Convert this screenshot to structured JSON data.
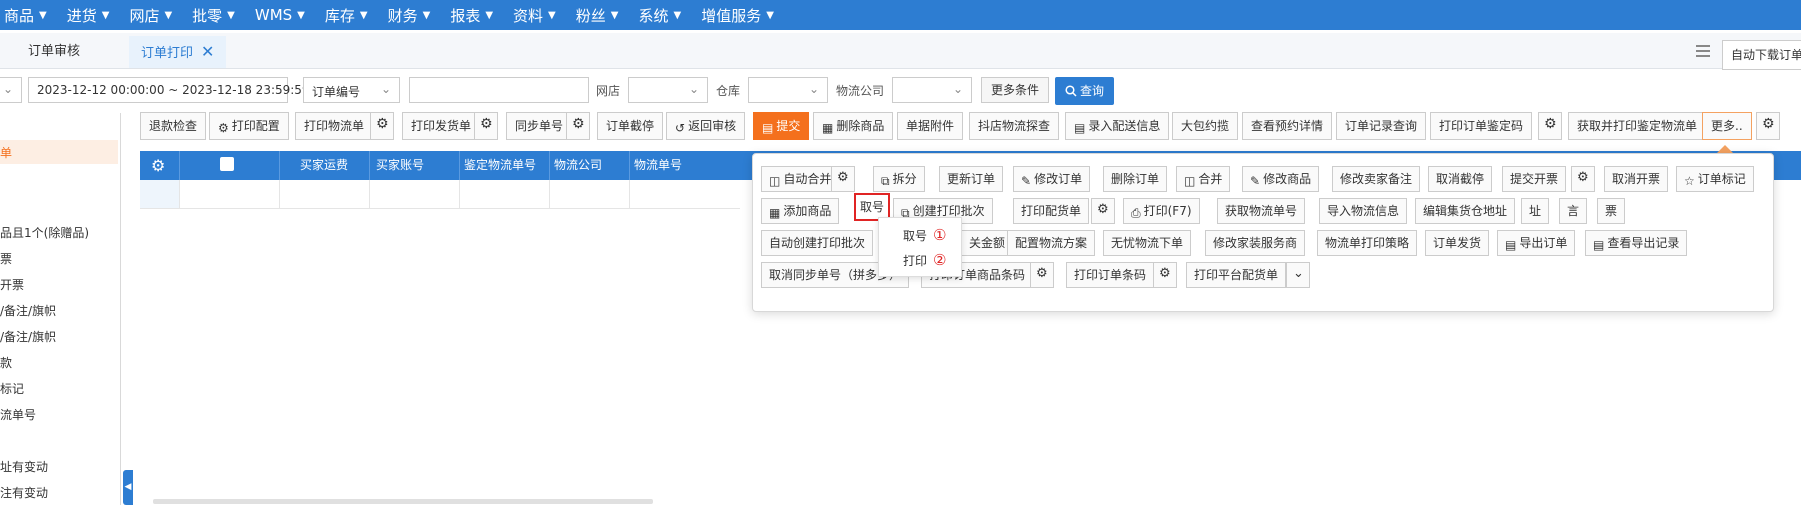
{
  "nav": {
    "items": [
      "商品",
      "进货",
      "网店",
      "批零",
      "WMS",
      "库存",
      "财务",
      "报表",
      "资料",
      "粉丝",
      "系统",
      "增值服务"
    ]
  },
  "tabs": {
    "items": [
      "订单审核",
      "订单打印"
    ],
    "active": "订单打印",
    "auto_download": "自动下载订单"
  },
  "filters": {
    "date_range": "2023-12-12 00:00:00 ~ 2023-12-18 23:59:59",
    "order_field": "订单编号",
    "order_value": "",
    "shop_label": "网店",
    "warehouse_label": "仓库",
    "logistics_label": "物流公司",
    "more_conditions": "更多条件",
    "query": "查询"
  },
  "left_panel": {
    "items": [
      "单",
      "品且1个(除赠品)",
      "票",
      "开票",
      "/备注/旗帜",
      "/备注/旗帜",
      "款",
      "标记",
      "流单号",
      "址有变动",
      "注有变动"
    ]
  },
  "toolbar": {
    "refund_check": "退款检查",
    "print_config": "打印配置",
    "print_logistics": "打印物流单",
    "print_shipping": "打印发货单",
    "sync_number": "同步单号",
    "order_intercept": "订单截停",
    "return_review": "返回审核",
    "submit": "提交",
    "delete_goods": "删除商品",
    "receipt_attach": "单据附件",
    "douyin_logistics": "抖店物流探查",
    "entry_delivery": "录入配送信息",
    "big_package": "大包约揽",
    "view_appointment": "查看预约详情",
    "order_record_query": "订单记录查询",
    "print_identify_code": "打印订单鉴定码",
    "fetch_print_identify": "获取并打印鉴定物流单",
    "more": "更多.."
  },
  "table": {
    "columns": [
      "买家运费",
      "买家账号",
      "鉴定物流单号",
      "物流公司",
      "物流单号"
    ]
  },
  "more_panel": {
    "row1": {
      "auto_merge": "自动合并",
      "split": "拆分",
      "update_order": "更新订单",
      "modify_order": "修改订单",
      "delete_order": "删除订单",
      "merge": "合并",
      "modify_goods": "修改商品",
      "modify_seller_note": "修改卖家备注",
      "cancel_intercept": "取消截停",
      "submit_invoice": "提交开票",
      "cancel_invoice": "取消开票",
      "order_mark": "订单标记"
    },
    "row2": {
      "add_goods": "添加商品",
      "take_number": "取号",
      "create_print_batch": "创建打印批次",
      "print_picking": "打印配货单",
      "print_f7": "打印(F7)",
      "get_logistics_number": "获取物流单号",
      "import_logistics": "导入物流信息",
      "edit_consolidation_address": "编辑集货仓地址",
      "addr": "址",
      "yan": "言",
      "piao": "票"
    },
    "row3": {
      "auto_create_print_batch": "自动创建打印批次",
      "amount": "关金额",
      "config_logistics_plan": "配置物流方案",
      "worry_free_logistics": "无忧物流下单",
      "modify_service_provider": "修改家装服务商",
      "logistics_print_strategy": "物流单打印策略",
      "order_ship": "订单发货",
      "export_order": "导出订单",
      "view_export_records": "查看导出记录"
    },
    "row4": {
      "cancel_sync_number": "取消同步单号（拼多多）",
      "print_order_barcode_goods": "打印订单商品条码",
      "print_order_barcode": "打印订单条码",
      "print_platform_picking": "打印平台配货单"
    }
  },
  "submenu": {
    "items": [
      {
        "label": "取号",
        "num": "①"
      },
      {
        "label": "打印",
        "num": "②"
      }
    ]
  }
}
